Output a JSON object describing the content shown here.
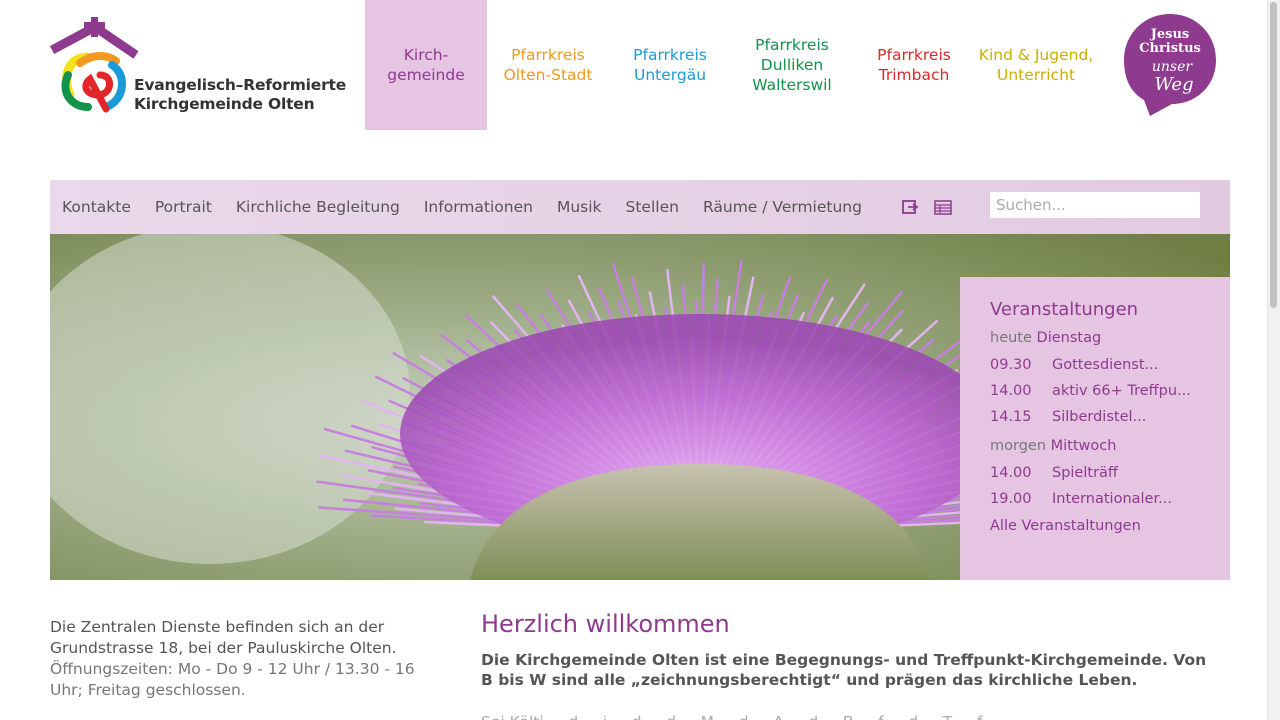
{
  "header": {
    "logo_text_line1": "Evangelisch–Reformierte",
    "logo_text_line2": "Kirchgemeinde Olten",
    "nav": [
      {
        "label": "Kirch-\ngemeinde",
        "color": "#8e3a8e"
      },
      {
        "label": "Pfarrkreis\nOlten-Stadt",
        "color": "#f29a1f"
      },
      {
        "label": "Pfarrkreis\nUntergäu",
        "color": "#1a9bd7"
      },
      {
        "label": "Pfarrkreis\nDulliken\nWalterswil",
        "color": "#12924a"
      },
      {
        "label": "Pfarrkreis\nTrimbach",
        "color": "#e2262a"
      },
      {
        "label": "Kind & Jugend,\nUnterricht",
        "color": "#c9b000"
      }
    ],
    "badge": {
      "line1": "Jesus",
      "line2": "Christus",
      "line3": "unser",
      "line4": "Weg",
      "color": "#8e3a8e"
    }
  },
  "menubar": {
    "items": [
      "Kontakte",
      "Portrait",
      "Kirchliche Begleitung",
      "Informationen",
      "Musik",
      "Stellen",
      "Räume / Vermietung"
    ],
    "login_icon": "login-icon",
    "calendar_icon": "table-icon",
    "search_placeholder": "Suchen..."
  },
  "events": {
    "title": "Veranstaltungen",
    "days": [
      {
        "prefix": "heute",
        "day": "Dienstag",
        "items": [
          {
            "time": "09.30",
            "name": "Gottesdienst..."
          },
          {
            "time": "14.00",
            "name": "aktiv 66+ Treffpu..."
          },
          {
            "time": "14.15",
            "name": "Silberdistel..."
          }
        ]
      },
      {
        "prefix": "morgen",
        "day": "Mittwoch",
        "items": [
          {
            "time": "14.00",
            "name": "Spielträff"
          },
          {
            "time": "19.00",
            "name": "Internationaler..."
          }
        ]
      }
    ],
    "all_link": "Alle Veranstaltungen"
  },
  "sidebar": {
    "lead": "Die Zentralen Dienste befinden sich an der Grundstrasse 18, bei der Pauluskirche Olten.",
    "hours": "Öffnungszeiten: Mo - Do 9 - 12 Uhr / 13.30 - 16 Uhr; Freitag geschlossen."
  },
  "main": {
    "title": "Herzlich willkommen",
    "intro": "Die Kirchgemeinde Olten ist eine Begegnungs- und Treffpunkt-Kirchgemeinde. Von B bis W sind alle „zeichnungsberechtigt“ und prägen das kirchliche Leben.",
    "cut_text": "Sei Kälti ... d ... i ... d ... d ... M ... d ... A ... d ... B ... f ... d ... T ... f"
  },
  "colors": {
    "accent": "#8e3a8e",
    "panel": "#e6c5e3",
    "menubar": "#e5d1e4"
  }
}
